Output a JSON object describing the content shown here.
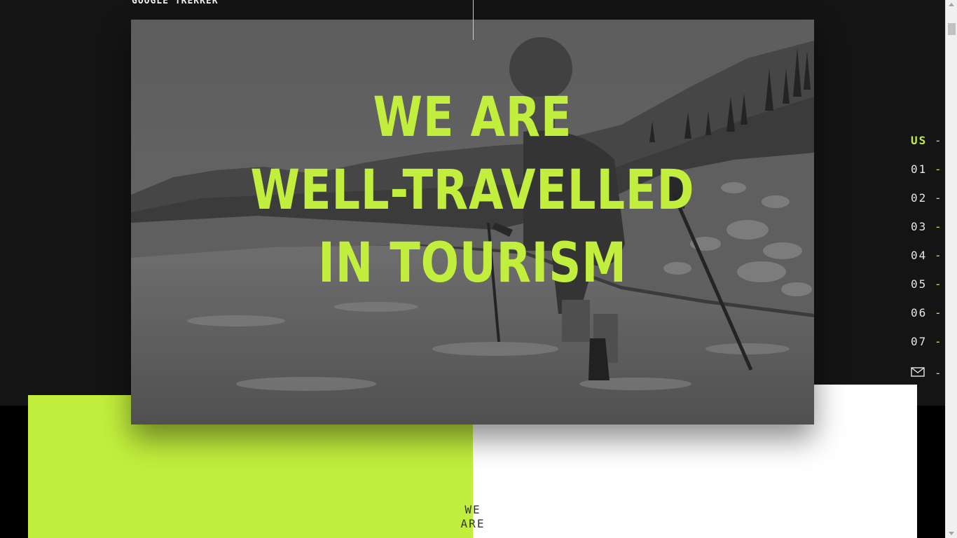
{
  "header": {
    "caption": "GOOGLE TREKKER"
  },
  "hero": {
    "headline_lines": [
      "WE ARE",
      "WELL-TRAVELLED",
      "IN TOURISM"
    ],
    "image_alt": "Hiker wearing a Google Street View Trekker backpack crossing a river"
  },
  "side_nav": {
    "items": [
      {
        "label": "US",
        "dash": "-",
        "active": true
      },
      {
        "label": "01",
        "dash": "-"
      },
      {
        "label": "02",
        "dash": "-"
      },
      {
        "label": "03",
        "dash": "-"
      },
      {
        "label": "04",
        "dash": "-"
      },
      {
        "label": "05",
        "dash": "-"
      },
      {
        "label": "06",
        "dash": "-"
      },
      {
        "label": "07",
        "dash": "-"
      }
    ],
    "mail": {
      "icon": "envelope-icon",
      "dash": "-"
    }
  },
  "section": {
    "we_are_line1": "WE",
    "we_are_line2": "ARE"
  },
  "colors": {
    "accent": "#c2ef3d",
    "background": "#141414",
    "band": "#000000"
  }
}
